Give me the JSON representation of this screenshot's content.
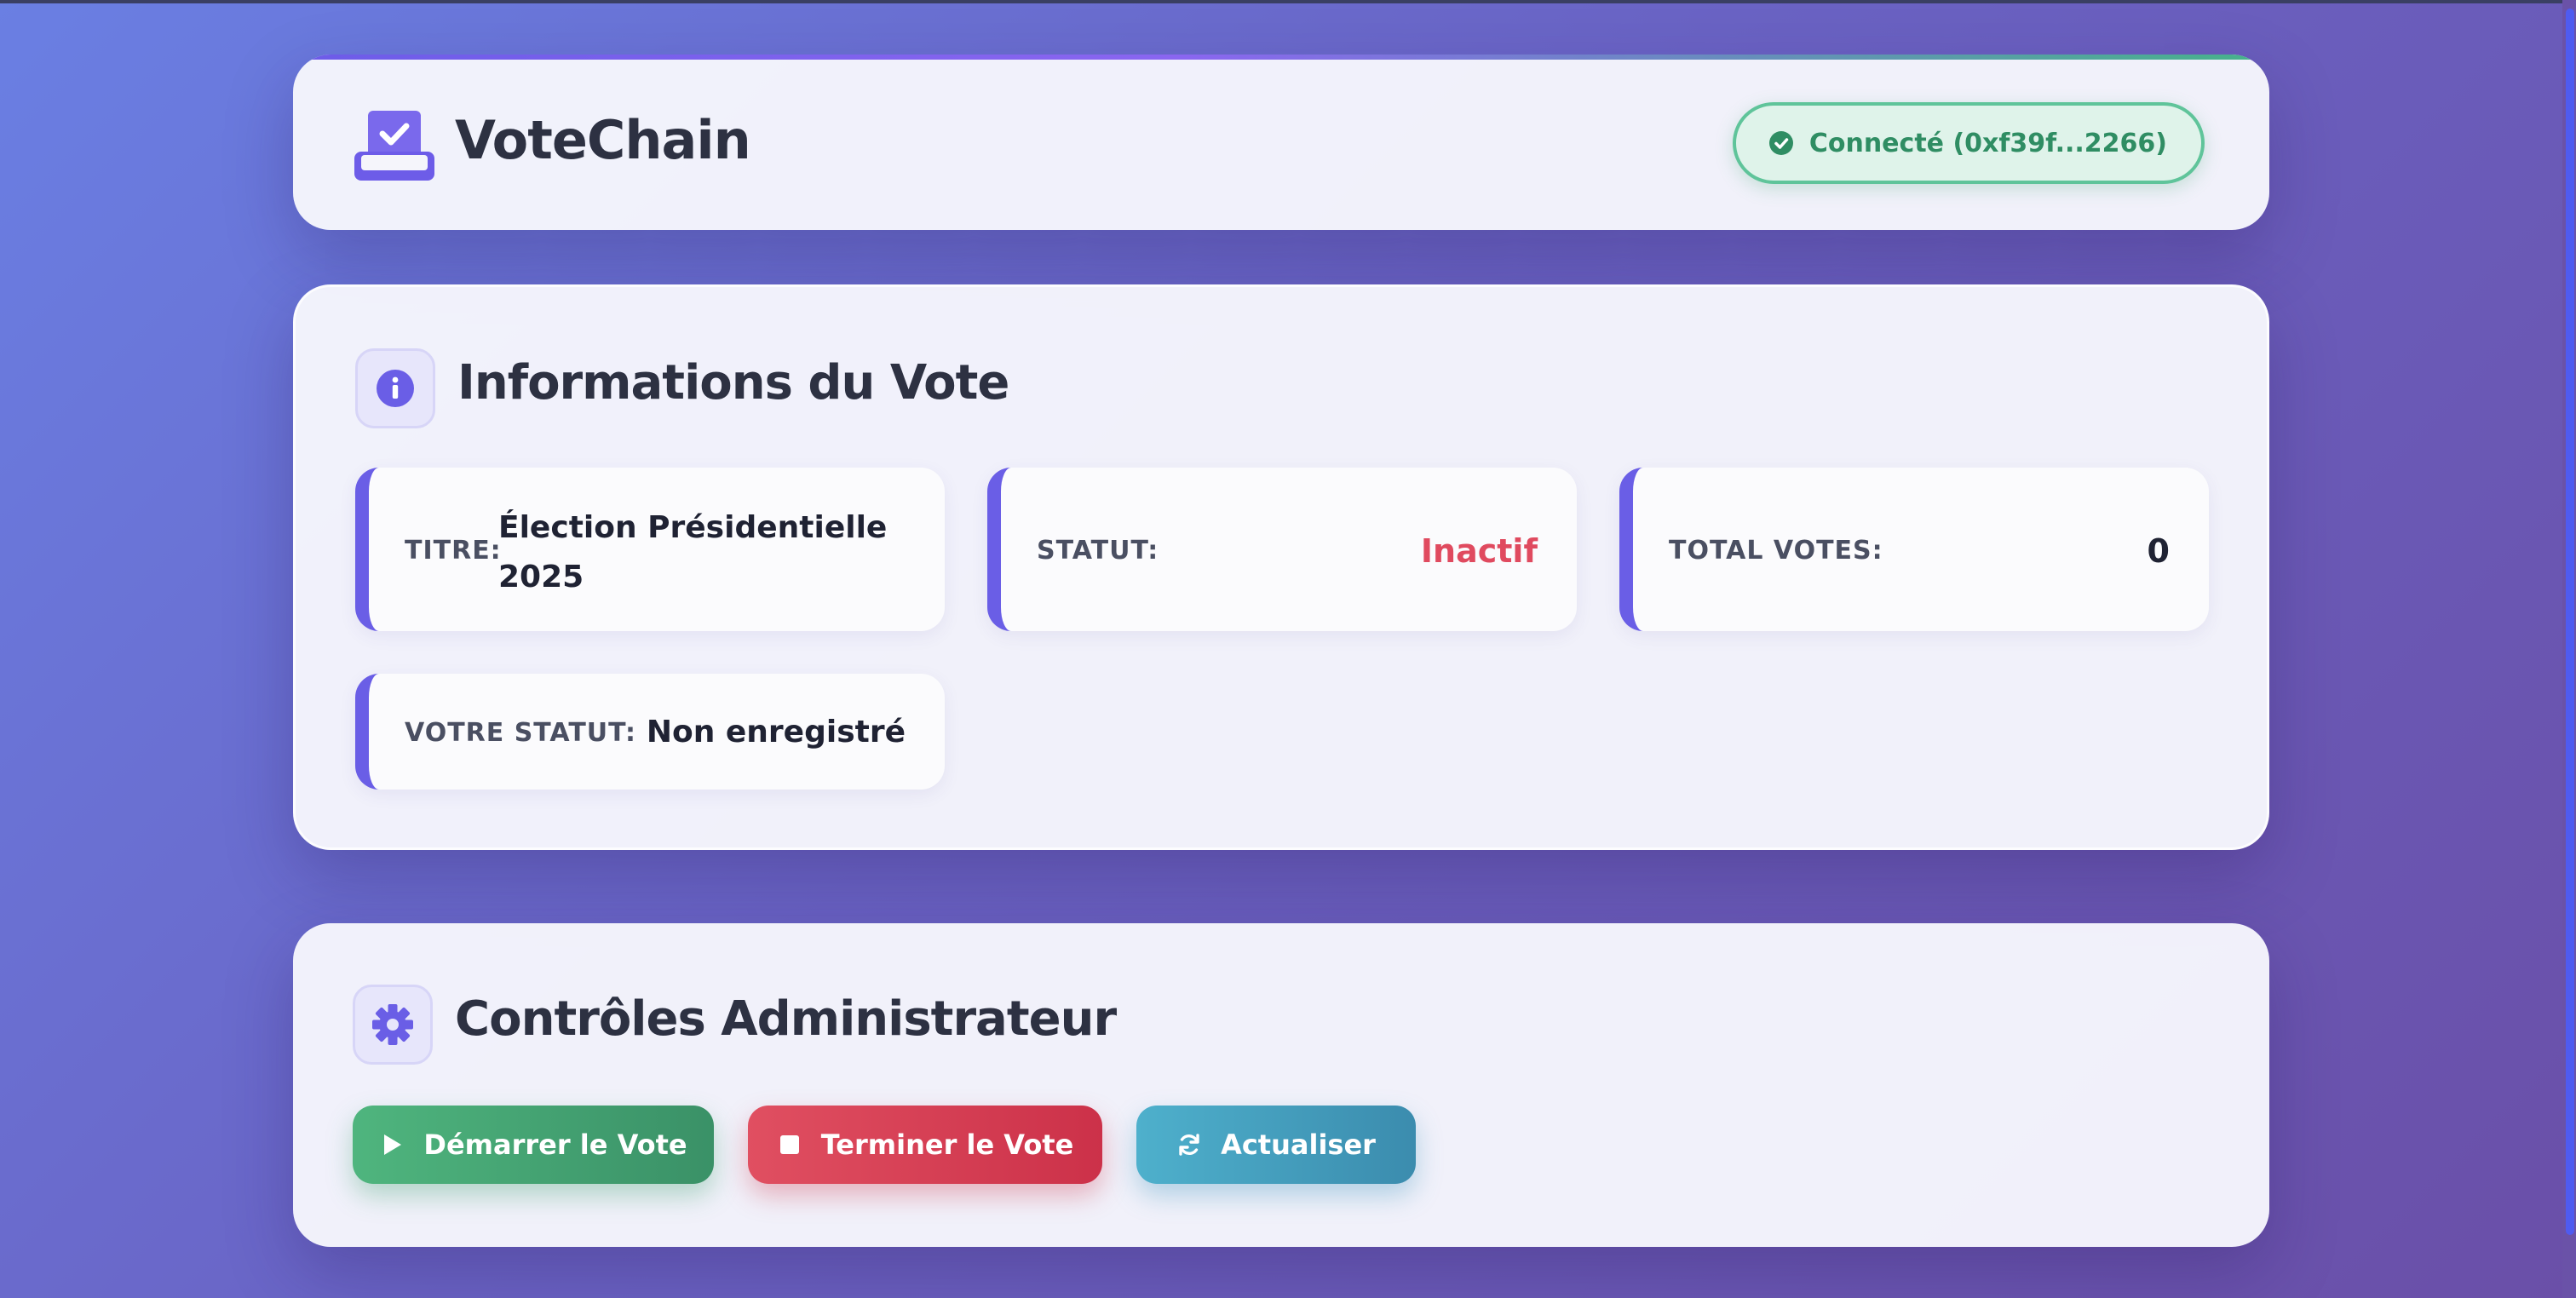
{
  "header": {
    "app_title": "VoteChain",
    "connection": "Connecté (0xf39f...2266)"
  },
  "info": {
    "section_title": "Informations du Vote",
    "title_label": "TITRE:",
    "title_value": "Élection Présidentielle 2025",
    "status_label": "STATUT:",
    "status_value": "Inactif",
    "total_label": "TOTAL VOTES:",
    "total_value": "0",
    "your_status_label": "VOTRE STATUT:",
    "your_status_value": "Non enregistré"
  },
  "admin": {
    "section_title": "Contrôles Administrateur",
    "start_label": "Démarrer le Vote",
    "stop_label": "Terminer le Vote",
    "refresh_label": "Actualiser"
  },
  "colors": {
    "accent": "#6a5ee6",
    "connected": "#2f8d63",
    "inactive": "#e04a5f",
    "start": "#4fb57e",
    "stop": "#e04f61",
    "refresh": "#4eb0cc"
  },
  "icons": {
    "logo": "vote-box-icon",
    "connected": "check-circle-icon",
    "info": "info-circle-icon",
    "admin": "gear-icon",
    "start": "play-icon",
    "stop": "stop-icon",
    "refresh": "refresh-icon"
  }
}
